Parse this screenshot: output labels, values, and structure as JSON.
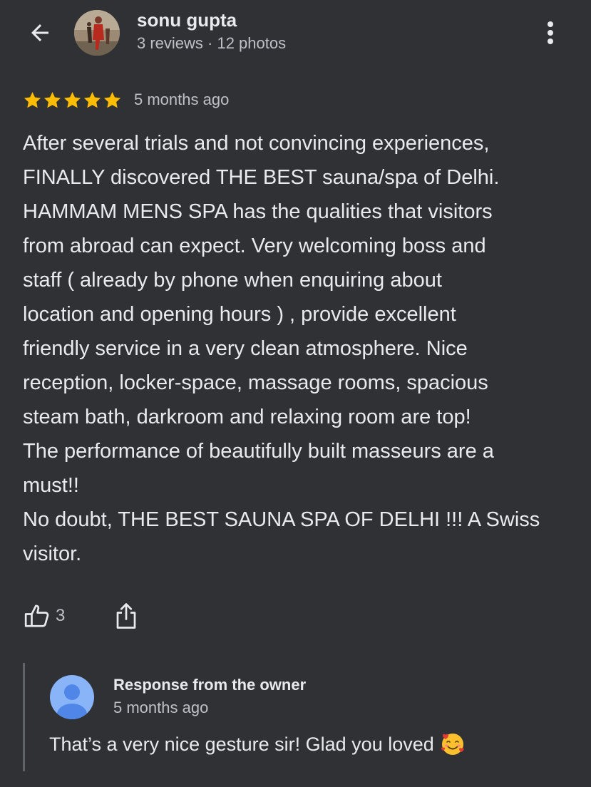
{
  "reviewer": {
    "name": "sonu gupta",
    "meta": "3 reviews · 12 photos"
  },
  "review": {
    "rating": 5,
    "rating_max": 5,
    "age": "5 months ago",
    "text": "After several trials and not convincing experiences,\nFINALLY discovered THE BEST sauna/spa of Delhi.\nHAMMAM MENS SPA has the qualities that visitors\nfrom abroad can expect. Very welcoming boss and\nstaff ( already by phone when enquiring about\nlocation and opening hours ) , provide excellent\nfriendly service in a very clean atmosphere. Nice\nreception, locker-space, massage rooms, spacious\nsteam bath, darkroom and relaxing room are top!\nThe performance of beautifully built masseurs are a\nmust!!\nNo doubt, THE BEST SAUNA SPA OF DELHI !!! A Swiss\nvisitor."
  },
  "actions": {
    "like_count": "3"
  },
  "owner_response": {
    "title": "Response from the owner",
    "age": "5 months ago",
    "text": "That’s a very nice gesture sir! Glad you loved"
  },
  "icons": {
    "back": "arrow-back-icon",
    "more": "more-vert-icon",
    "star": "star-icon",
    "like": "thumb-up-icon",
    "share": "share-icon",
    "owner_avatar": "person-icon",
    "emoji": "smiling-face-with-hearts-icon"
  },
  "colors": {
    "background": "#303134",
    "text_primary": "#e8eaed",
    "text_secondary": "#bdc1c6",
    "star": "#fbbc04",
    "avatar_blue": "#8ab4f8",
    "avatar_blue_dark": "#4f86e8"
  }
}
